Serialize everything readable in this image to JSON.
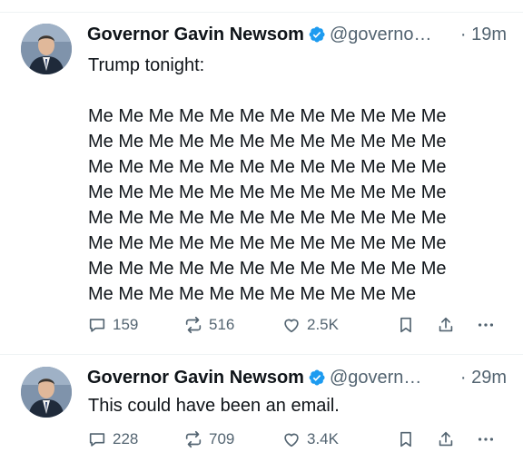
{
  "tweets": [
    {
      "name": "Governor Gavin Newsom",
      "handle": "@governo…",
      "time": "· 19m",
      "text": "Trump tonight:\n\nMe Me Me Me Me Me Me Me Me Me Me Me\nMe Me Me Me Me Me Me Me Me Me Me Me\nMe Me Me Me Me Me Me Me Me Me Me Me\nMe Me Me Me Me Me Me Me Me Me Me Me\nMe Me Me Me Me Me Me Me Me Me Me Me\nMe Me Me Me Me Me Me Me Me Me Me Me\nMe Me Me Me Me Me Me Me Me Me Me Me\nMe Me Me Me Me Me Me Me Me Me Me",
      "replies": "159",
      "reposts": "516",
      "likes": "2.5K"
    },
    {
      "name": "Governor Gavin Newsom",
      "handle": "@govern…",
      "time": "· 29m",
      "text": "This could have been an email.",
      "replies": "228",
      "reposts": "709",
      "likes": "3.4K"
    }
  ],
  "colors": {
    "verified": "#1d9bf0",
    "muted": "#536471",
    "text": "#0f1419",
    "border": "#eff3f4"
  },
  "icons": [
    "verified-badge-icon",
    "reply-icon",
    "repost-icon",
    "like-icon",
    "bookmark-icon",
    "share-icon",
    "more-icon"
  ]
}
